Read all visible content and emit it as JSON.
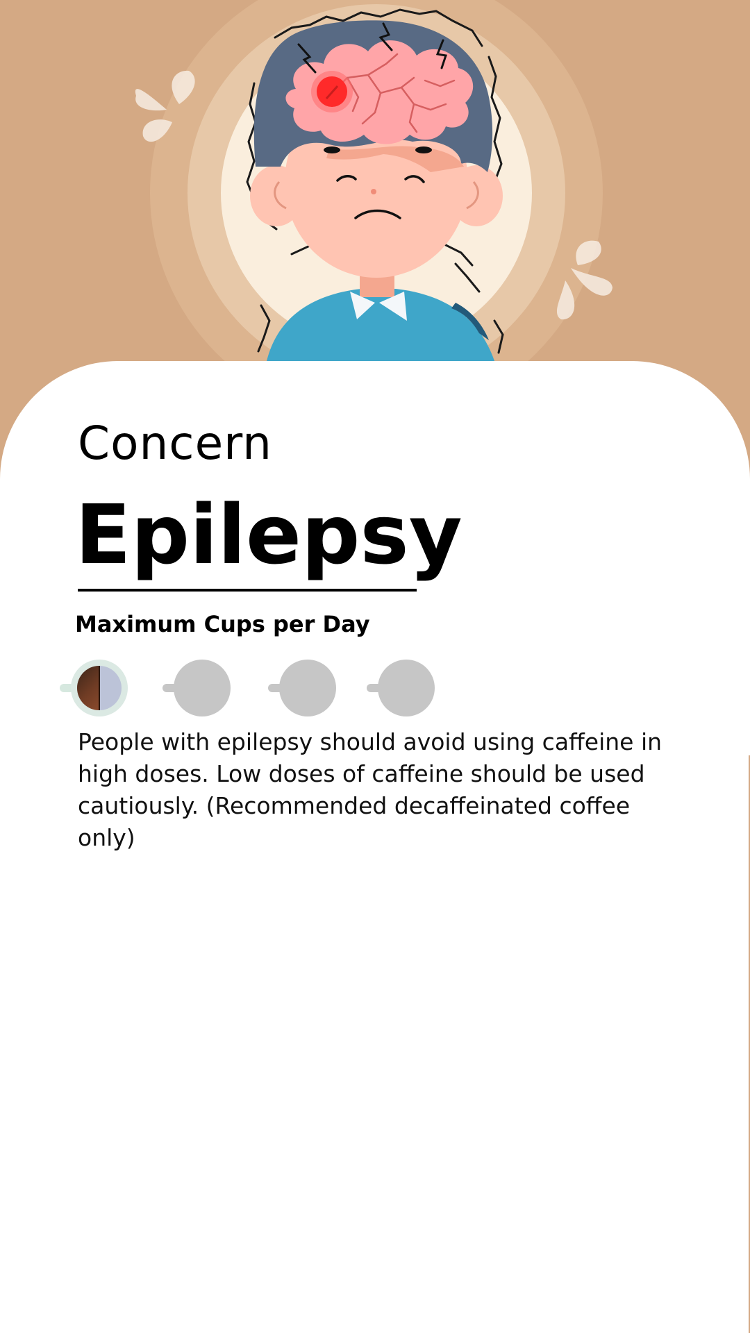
{
  "subtitle": "Concern",
  "title": "Epilepsy",
  "cups": {
    "label": "Maximum Cups per Day",
    "filled": 0.5,
    "total": 4
  },
  "description": "People with epilepsy should avoid using caffeine in high doses. Low doses of caffeine should be used cautiously. (Recommended decaffeinated coffee only)",
  "colors": {
    "background": "#d4a984",
    "card": "#ffffff",
    "cup_empty": "#c6c6c6",
    "coffee": "#6e3b24",
    "brain_alert": "#ff2a2a",
    "shirt": "#3fa6c9"
  }
}
